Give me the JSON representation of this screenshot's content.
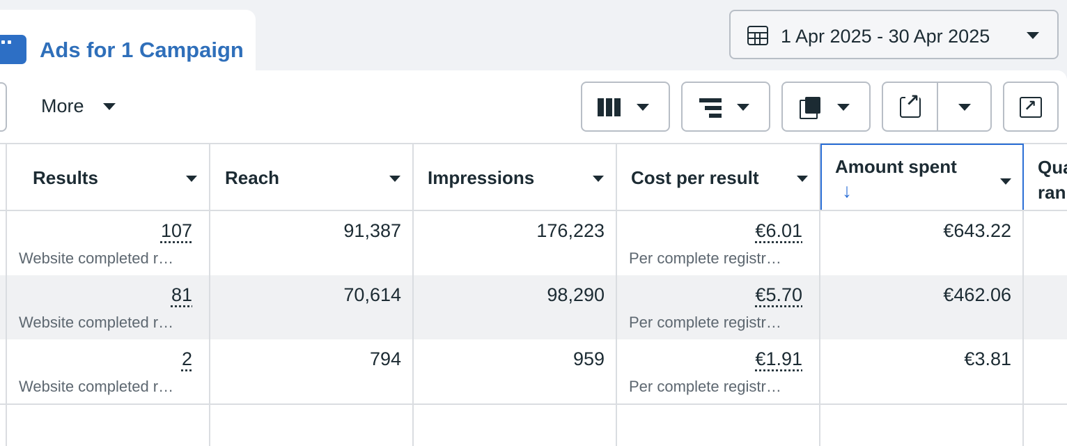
{
  "tab": {
    "label": "Ads for 1 Campaign",
    "icon": "ads-icon"
  },
  "date_range": {
    "value": "1 Apr 2025 - 30 Apr 2025",
    "icon": "calendar-icon"
  },
  "toolbar": {
    "more_label": "More",
    "buttons": [
      "columns-icon",
      "breakdown-icon",
      "reports-icon",
      "export-icon",
      "chart-icon"
    ]
  },
  "table": {
    "headers": {
      "results": "Results",
      "reach": "Reach",
      "impressions": "Impressions",
      "cost_per_result": "Cost per result",
      "amount_spent": "Amount spent",
      "quality_line1": "Qua",
      "quality_line2": "ran"
    },
    "sorted_column": "Amount spent",
    "sort_direction": "descending",
    "rows": [
      {
        "results": "107",
        "results_sub": "Website completed r…",
        "reach": "91,387",
        "impressions": "176,223",
        "cost_per_result": "€6.01",
        "cost_sub": "Per complete registr…",
        "amount_spent": "€643.22"
      },
      {
        "results": "81",
        "results_sub": "Website completed r…",
        "reach": "70,614",
        "impressions": "98,290",
        "cost_per_result": "€5.70",
        "cost_sub": "Per complete registr…",
        "amount_spent": "€462.06"
      },
      {
        "results": "2",
        "results_sub": "Website completed r…",
        "reach": "794",
        "impressions": "959",
        "cost_per_result": "€1.91",
        "cost_sub": "Per complete registr…",
        "amount_spent": "€3.81"
      }
    ]
  },
  "colors": {
    "accent": "#2b6fd6",
    "tab_text": "#2f6fba",
    "row_alt": "#f0f1f3"
  }
}
